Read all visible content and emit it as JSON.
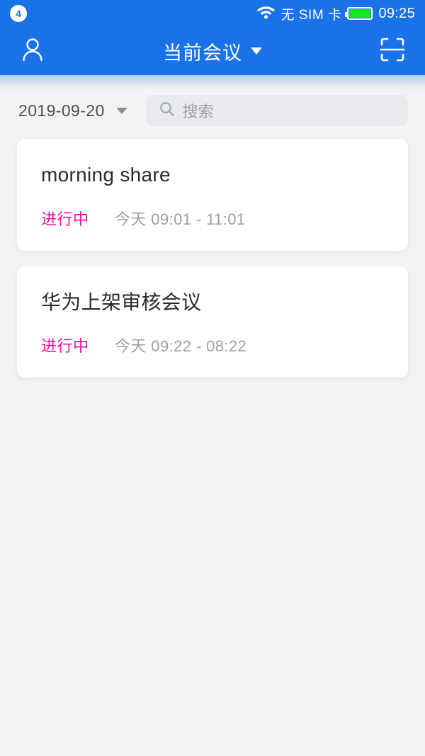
{
  "status_bar": {
    "notification_count": "4",
    "wifi_icon": "wifi-icon",
    "sim_status": "无 SIM 卡",
    "battery_icon": "battery-full-icon",
    "battery_color": "#19e619",
    "time": "09:25"
  },
  "header": {
    "profile_icon": "person-icon",
    "title": "当前会议",
    "title_caret_icon": "chevron-down-icon",
    "scan_icon": "scan-qr-icon",
    "background_color": "#1a72e8"
  },
  "filter": {
    "date": "2019-09-20",
    "date_caret_icon": "chevron-down-icon",
    "search_icon": "search-icon",
    "search_value": "",
    "search_placeholder": "搜索"
  },
  "meetings": [
    {
      "title": "morning share",
      "status": "进行中",
      "status_color": "#e6119c",
      "day_label": "今天",
      "time_range": "09:01 - 11:01",
      "time_text": "今天 09:01 - 11:01"
    },
    {
      "title": "华为上架审核会议",
      "status": "进行中",
      "status_color": "#e6119c",
      "day_label": "今天",
      "time_range": "09:22 - 08:22",
      "time_text": "今天 09:22 - 08:22"
    }
  ],
  "theme": {
    "page_background": "#f2f3f5",
    "card_background": "#ffffff",
    "accent": "#1a72e8"
  }
}
